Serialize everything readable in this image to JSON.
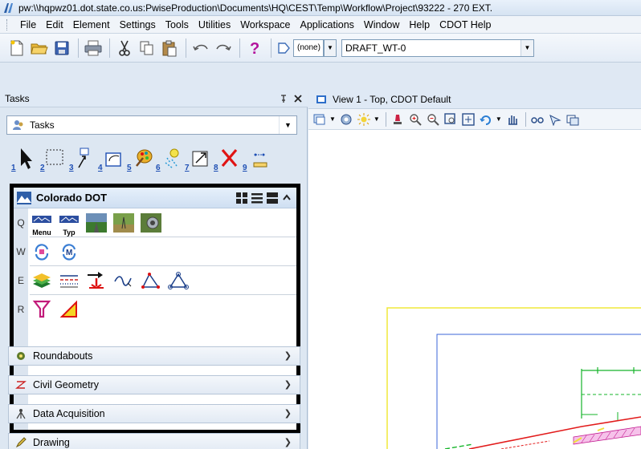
{
  "window": {
    "title": "pw:\\\\hqpwz01.dot.state.co.us:PwiseProduction\\Documents\\HQ\\CEST\\Temp\\Workflow\\Project\\93222 - 270 EXT."
  },
  "menu": {
    "items": [
      {
        "label": "File"
      },
      {
        "label": "Edit"
      },
      {
        "label": "Element"
      },
      {
        "label": "Settings"
      },
      {
        "label": "Tools"
      },
      {
        "label": "Utilities"
      },
      {
        "label": "Workspace"
      },
      {
        "label": "Applications"
      },
      {
        "label": "Window"
      },
      {
        "label": "Help"
      },
      {
        "label": "CDOT Help"
      }
    ]
  },
  "toolbar": {
    "level_combo": "(none)",
    "style_combo": "DRAFT_WT-0",
    "icons": [
      "new-file-icon",
      "open-folder-icon",
      "save-icon",
      "print-icon",
      "cut-icon",
      "copy-icon",
      "paste-icon",
      "undo-icon",
      "redo-icon",
      "help-icon"
    ]
  },
  "tasks": {
    "header": "Tasks",
    "select_value": "Tasks",
    "numbered_tools": [
      "1",
      "2",
      "3",
      "4",
      "5",
      "6",
      "7",
      "8",
      "9"
    ],
    "cdot": {
      "title": "Colorado DOT",
      "rows": [
        {
          "letter": "Q",
          "captions": [
            "Menu",
            "Typ"
          ]
        },
        {
          "letter": "W"
        },
        {
          "letter": "E"
        },
        {
          "letter": "R"
        }
      ]
    },
    "accordions": [
      {
        "label": "Roundabouts"
      },
      {
        "label": "Civil Geometry"
      },
      {
        "label": "Data Acquisition"
      },
      {
        "label": "Drawing"
      }
    ]
  },
  "view": {
    "tab_label": "View 1 - Top, CDOT Default"
  }
}
